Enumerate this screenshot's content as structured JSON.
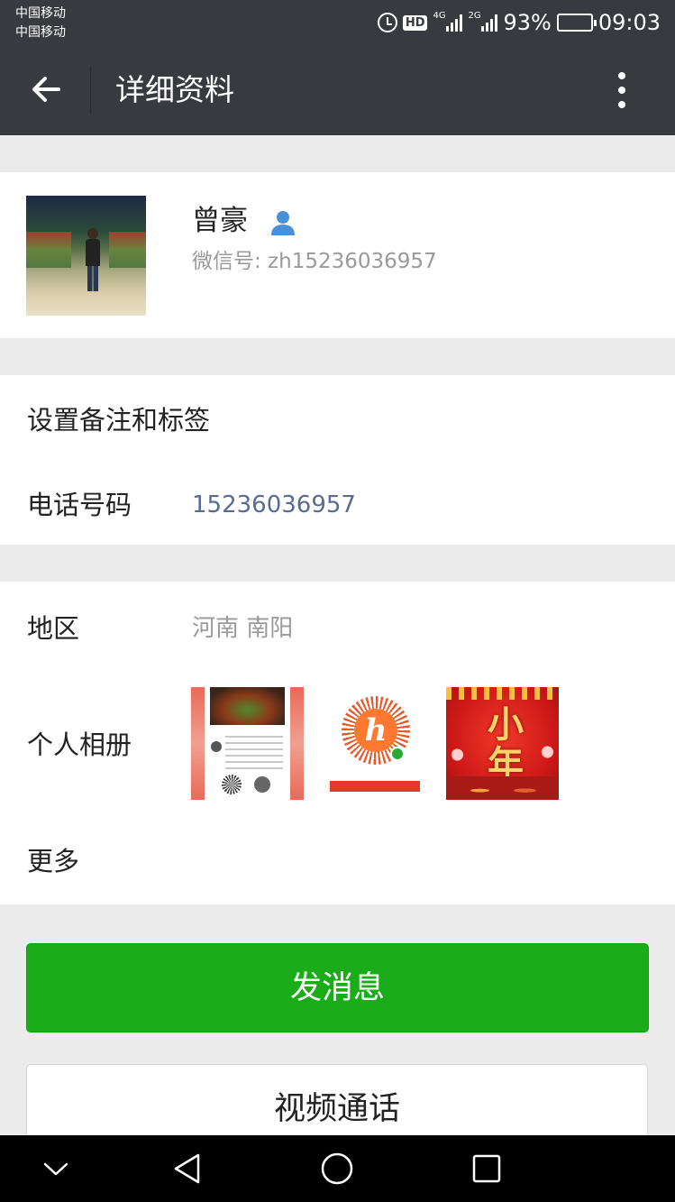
{
  "status_bar": {
    "carrier_1": "中国移动",
    "carrier_2": "中国移动",
    "hd_label": "HD",
    "network_1": "4G",
    "network_2": "2G",
    "battery": "93%",
    "time": "09:03"
  },
  "header": {
    "title": "详细资料",
    "back_icon": "arrow-left-icon",
    "more_icon": "more-vertical-icon"
  },
  "profile": {
    "nickname": "曾豪",
    "badge_icon": "person-icon",
    "wechat_id": "微信号: zh15236036957"
  },
  "contact": {
    "remark_label": "设置备注和标签",
    "phone_label": "电话号码",
    "phone_value": "15236036957"
  },
  "info": {
    "region_label": "地区",
    "region_value": "河南  南阳",
    "album_label": "个人相册",
    "more_label": "更多"
  },
  "album": {
    "thumb_3_text": "小年"
  },
  "actions": {
    "send_message": "发消息",
    "video_call": "视频通话"
  },
  "colors": {
    "titlebar": "#393a3f",
    "primary_button": "#1aad19",
    "link": "#576b95",
    "background": "#ebebeb"
  }
}
